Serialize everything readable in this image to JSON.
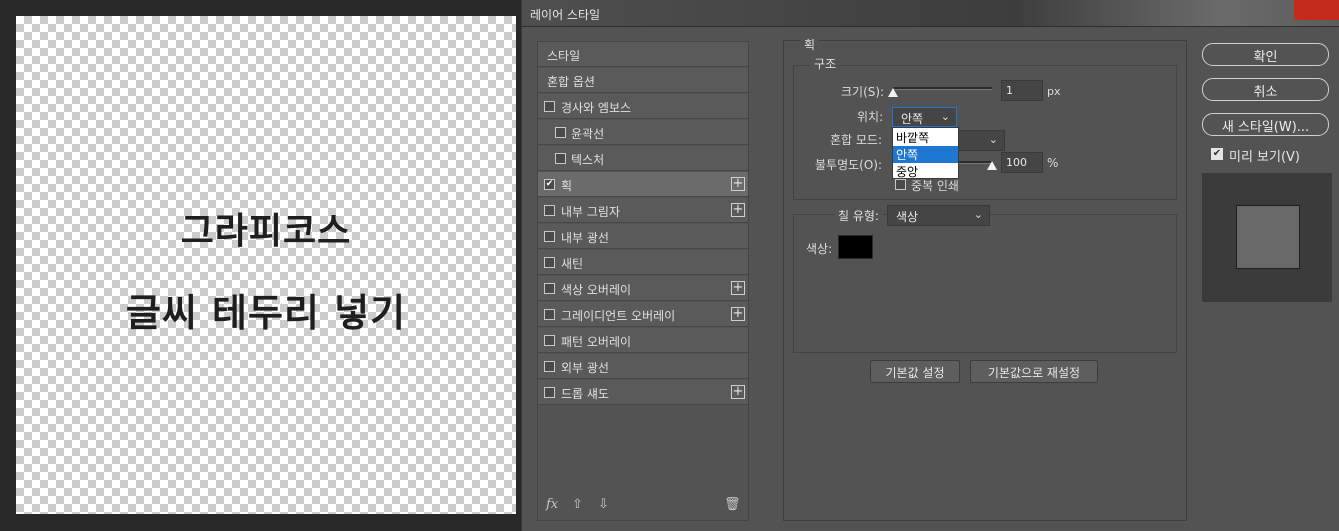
{
  "canvas": {
    "line1": "그라피코스",
    "line2": "글씨 테두리 넣기"
  },
  "dialog": {
    "title": "레이어 스타일"
  },
  "style_list": {
    "items": [
      {
        "label": "스타일",
        "checkbox": false,
        "checked": false,
        "plus": false,
        "indent": false,
        "selected": false
      },
      {
        "label": "혼합 옵션",
        "checkbox": false,
        "checked": false,
        "plus": false,
        "indent": false,
        "selected": false
      },
      {
        "label": "경사와 엠보스",
        "checkbox": true,
        "checked": false,
        "plus": false,
        "indent": false,
        "selected": false
      },
      {
        "label": "윤곽선",
        "checkbox": true,
        "checked": false,
        "plus": false,
        "indent": true,
        "selected": false
      },
      {
        "label": "텍스처",
        "checkbox": true,
        "checked": false,
        "plus": false,
        "indent": true,
        "selected": false
      },
      {
        "label": "획",
        "checkbox": true,
        "checked": true,
        "plus": true,
        "indent": false,
        "selected": true
      },
      {
        "label": "내부 그림자",
        "checkbox": true,
        "checked": false,
        "plus": true,
        "indent": false,
        "selected": false
      },
      {
        "label": "내부 광선",
        "checkbox": true,
        "checked": false,
        "plus": false,
        "indent": false,
        "selected": false
      },
      {
        "label": "새틴",
        "checkbox": true,
        "checked": false,
        "plus": false,
        "indent": false,
        "selected": false
      },
      {
        "label": "색상 오버레이",
        "checkbox": true,
        "checked": false,
        "plus": true,
        "indent": false,
        "selected": false
      },
      {
        "label": "그레이디언트 오버레이",
        "checkbox": true,
        "checked": false,
        "plus": true,
        "indent": false,
        "selected": false
      },
      {
        "label": "패턴 오버레이",
        "checkbox": true,
        "checked": false,
        "plus": false,
        "indent": false,
        "selected": false
      },
      {
        "label": "외부 광선",
        "checkbox": true,
        "checked": false,
        "plus": false,
        "indent": false,
        "selected": false
      },
      {
        "label": "드롭 섀도",
        "checkbox": true,
        "checked": false,
        "plus": true,
        "indent": false,
        "selected": false
      }
    ],
    "footer": {
      "fx": "fx",
      "up": "⇧",
      "down": "⇩",
      "trash": "🗑"
    }
  },
  "stroke": {
    "section_title": "획",
    "structure_title": "구조",
    "size_label": "크기(S):",
    "size_value": "1",
    "size_unit": "px",
    "size_fraction": 0.0,
    "position_label": "위치:",
    "position_value": "안쪽",
    "position_options": [
      "바깥쪽",
      "안쪽",
      "중앙"
    ],
    "position_selected_index": 1,
    "blend_label": "혼합 모드:",
    "opacity_label": "불투명도(O):",
    "opacity_value": "100",
    "opacity_unit": "%",
    "opacity_fraction": 1.0,
    "overprint_label": "중복 인쇄",
    "fill_type_label": "칠 유형:",
    "fill_type_value": "색상",
    "color_label": "색상:",
    "color_hex": "#000000",
    "default_button": "기본값 설정",
    "reset_button": "기본값으로 재설정"
  },
  "right_panel": {
    "ok": "확인",
    "cancel": "취소",
    "new_style": "새 스타일(W)...",
    "preview_label": "미리 보기(V)",
    "preview_checked": true
  }
}
